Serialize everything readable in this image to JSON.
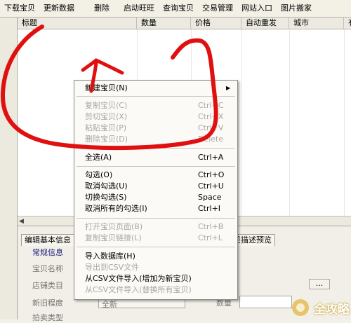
{
  "toolbar": {
    "items": [
      "下载宝贝",
      "更新数据",
      "删除",
      "启动旺旺",
      "查询宝贝",
      "交易管理",
      "网站入口",
      "图片搬家"
    ]
  },
  "grid": {
    "columns": [
      "标题",
      "数量",
      "价格",
      "自动重发",
      "城市",
      "有"
    ]
  },
  "context_menu": {
    "new_item": {
      "label": "新建宝贝(N)",
      "shortcut": ""
    },
    "copy": {
      "label": "复制宝贝(C)",
      "shortcut": "Ctrl+C"
    },
    "cut": {
      "label": "剪切宝贝(X)",
      "shortcut": "Ctrl+X"
    },
    "paste": {
      "label": "粘贴宝贝(P)",
      "shortcut": "Ctrl+V"
    },
    "delete": {
      "label": "删除宝贝(D)",
      "shortcut": "Delete"
    },
    "select_all": {
      "label": "全选(A)",
      "shortcut": "Ctrl+A"
    },
    "check": {
      "label": "勾选(O)",
      "shortcut": "Ctrl+O"
    },
    "uncheck": {
      "label": "取消勾选(U)",
      "shortcut": "Ctrl+U"
    },
    "toggle_check": {
      "label": "切换勾选(S)",
      "shortcut": "Space"
    },
    "uncheck_all": {
      "label": "取消所有的勾选(I)",
      "shortcut": "Ctrl+I"
    },
    "open_page": {
      "label": "打开宝贝页面(B)",
      "shortcut": "Ctrl+B"
    },
    "copy_link": {
      "label": "复制宝贝链接(L)",
      "shortcut": "Ctrl+L"
    },
    "import_db": {
      "label": "导入数据库(H)",
      "shortcut": ""
    },
    "export_csv": {
      "label": "导出到CSV文件",
      "shortcut": ""
    },
    "import_csv_new": {
      "label": "从CSV文件导入(增加为新宝贝)",
      "shortcut": ""
    },
    "import_csv_replace": {
      "label": "从CSV文件导入(替换所有宝贝)",
      "shortcut": ""
    }
  },
  "bottom_panel": {
    "tab_edit": "编辑基本信息",
    "tab_preview": "宝贝描述预览",
    "section": "常规信息",
    "name_label": "宝贝名称",
    "category_label": "店铺类目",
    "condition_label": "新旧程度",
    "condition_value": "全新",
    "quantity_label": "数量",
    "more_button": "...",
    "extra_label": "拍卖类型"
  },
  "watermark": {
    "text": "全攻略"
  },
  "colors": {
    "annotation_red": "#e01010",
    "menu_bg": "#fbfaf7"
  }
}
